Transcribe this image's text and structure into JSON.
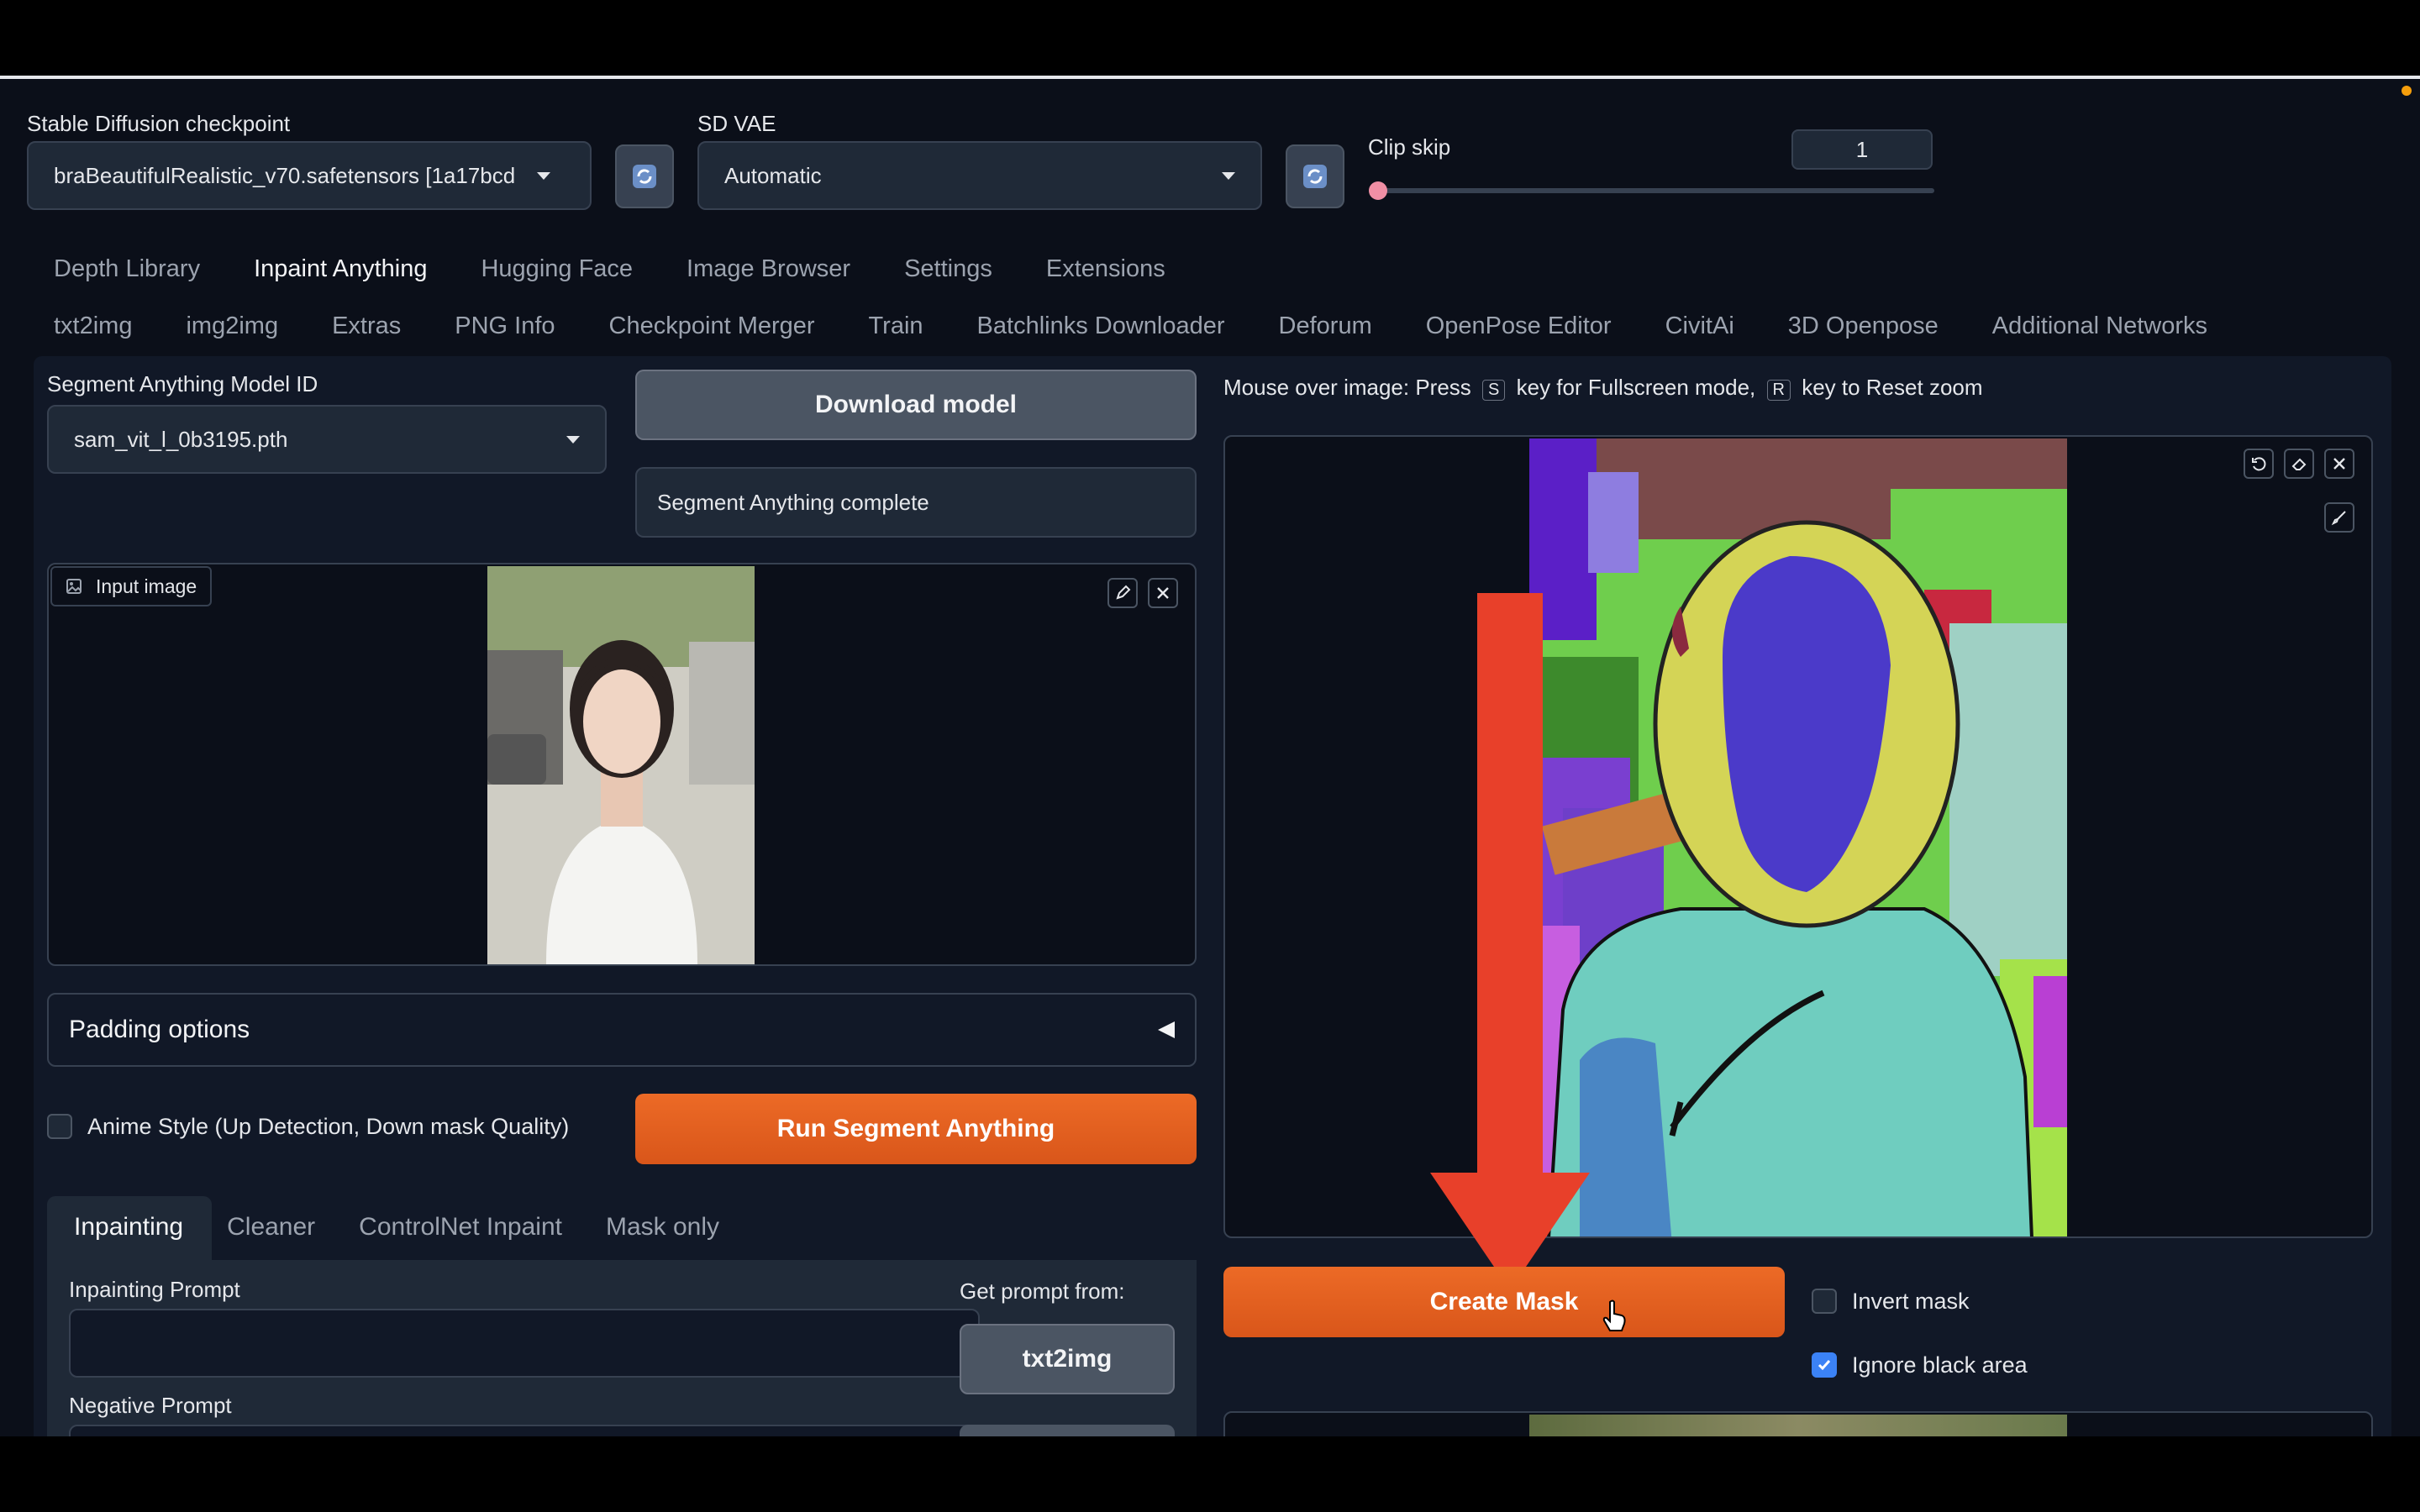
{
  "top": {
    "checkpoint_label": "Stable Diffusion checkpoint",
    "checkpoint_value": "braBeautifulRealistic_v70.safetensors [1a17bcd",
    "vae_label": "SD VAE",
    "vae_value": "Automatic",
    "clip_label": "Clip skip",
    "clip_value": "1"
  },
  "tabs_row1": [
    "Depth Library",
    "Inpaint Anything",
    "Hugging Face",
    "Image Browser",
    "Settings",
    "Extensions"
  ],
  "tabs_row2": [
    "txt2img",
    "img2img",
    "Extras",
    "PNG Info",
    "Checkpoint Merger",
    "Train",
    "Batchlinks Downloader",
    "Deforum",
    "OpenPose Editor",
    "CivitAi",
    "3D Openpose",
    "Additional Networks"
  ],
  "left": {
    "model_label": "Segment Anything Model ID",
    "model_value": "sam_vit_l_0b3195.pth",
    "download_btn": "Download model",
    "status": "Segment Anything complete",
    "input_image_label": "Input image",
    "padding_label": "Padding options",
    "anime_label": "Anime Style (Up Detection, Down mask Quality)",
    "run_btn": "Run Segment Anything",
    "subtabs": [
      "Inpainting",
      "Cleaner",
      "ControlNet Inpaint",
      "Mask only"
    ],
    "inpaint_prompt_label": "Inpainting Prompt",
    "negative_prompt_label": "Negative Prompt",
    "get_prompt_label": "Get prompt from:",
    "txt2img_btn": "txt2img"
  },
  "right": {
    "hint_part1": "Mouse over image: Press",
    "key_s": "S",
    "hint_part2": "key for Fullscreen mode,",
    "key_r": "R",
    "hint_part3": "key to Reset zoom",
    "create_mask_btn": "Create Mask",
    "invert_label": "Invert mask",
    "ignore_label": "Ignore black area"
  },
  "colors": {
    "accent": "#e35c1c",
    "arrow": "#e8402a",
    "checkbox_on": "#3b82f6"
  }
}
